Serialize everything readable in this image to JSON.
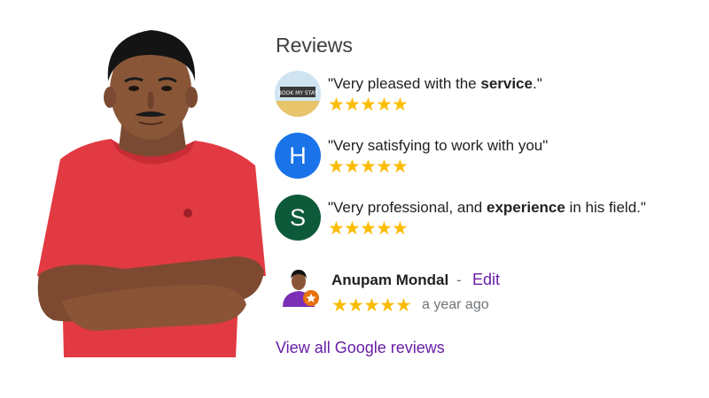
{
  "reviews_panel": {
    "title": "Reviews",
    "items": [
      {
        "avatar_letter": "",
        "avatar_image_text": "BOOK MY STAY",
        "quote_before": "\"Very pleased with the ",
        "quote_bold": "service",
        "quote_after": ".\"",
        "rating": 5
      },
      {
        "avatar_letter": "H",
        "avatar_color": "#1a73e8",
        "quote_before": "\"Very satisfying to work with you\"",
        "quote_bold": "",
        "quote_after": "",
        "rating": 5
      },
      {
        "avatar_letter": "S",
        "avatar_color": "#0d5a3a",
        "quote_before": "\"Very professional, and ",
        "quote_bold": "experience",
        "quote_after": " in his field.\"",
        "rating": 5
      }
    ],
    "own_review": {
      "name": "Anupam Mondal",
      "separator": "-",
      "edit_label": "Edit",
      "rating": 5,
      "time_ago": "a year ago"
    },
    "view_all_label": "View all Google reviews"
  },
  "colors": {
    "star": "#fbbc04",
    "link": "#681da8",
    "shirt": "#e0363f"
  },
  "icons": {
    "star": "★"
  }
}
